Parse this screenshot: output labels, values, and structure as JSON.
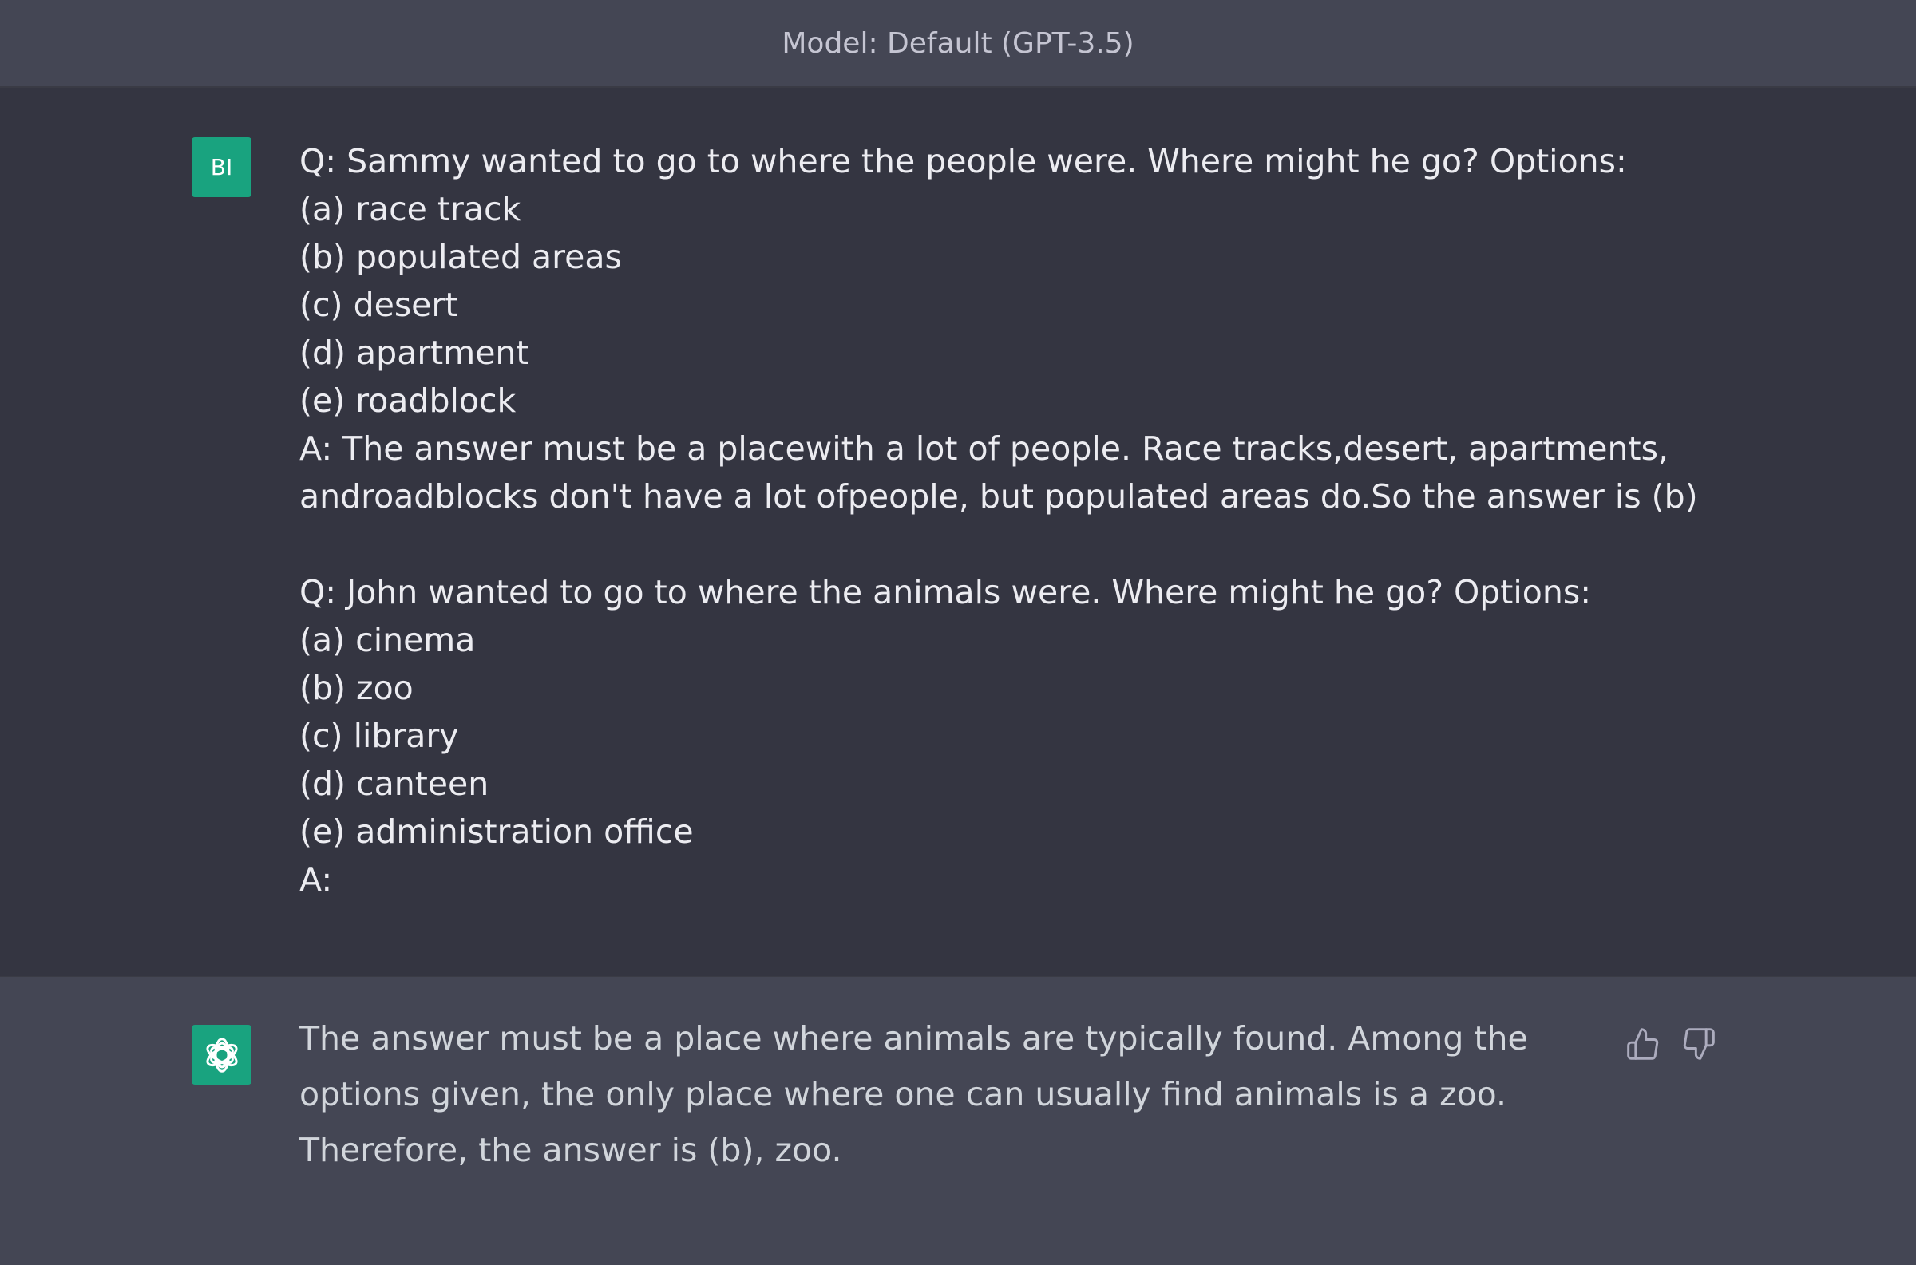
{
  "header": {
    "model_label": "Model: Default (GPT-3.5)"
  },
  "user": {
    "avatar_initials": "BI",
    "lines": [
      "Q: Sammy wanted to go to where the people were. Where might he go? Options:",
      "(a) race track",
      "(b) populated areas",
      "(c) desert",
      "(d) apartment",
      "(e) roadblock",
      "A: The answer must be a placewith a lot of people. Race tracks,desert, apartments,",
      "androadblocks don't have a lot ofpeople, but populated areas do.So the answer is (b)",
      "",
      "Q: John wanted to go to where the animals were. Where might he go? Options:",
      "(a) cinema",
      "(b) zoo",
      "(c) library",
      "(d) canteen",
      "(e) administration office",
      "A:"
    ]
  },
  "assistant": {
    "avatar_icon": "openai-logo-icon",
    "response": "The answer must be a place where animals are typically found. Among the options given, the only place where one can usually find animals is a zoo. Therefore, the answer is (b), zoo.",
    "feedback": {
      "thumbs_up_icon": "thumbs-up-icon",
      "thumbs_down_icon": "thumbs-down-icon"
    }
  },
  "colors": {
    "user_bg": "#343541",
    "assistant_bg": "#444654",
    "avatar_bg": "#19a37f",
    "text": "#ececf1"
  }
}
